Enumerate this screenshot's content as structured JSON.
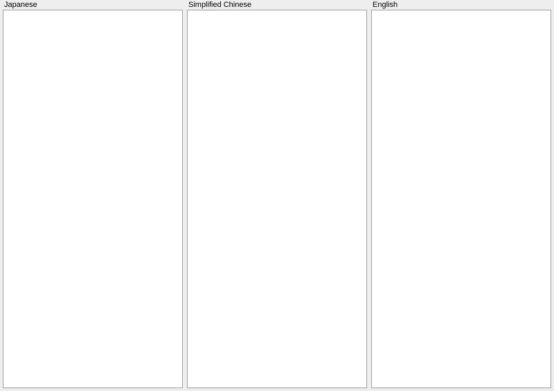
{
  "panels": [
    {
      "label": "Japanese",
      "value": ""
    },
    {
      "label": "Simplified Chinese",
      "value": ""
    },
    {
      "label": "English",
      "value": ""
    }
  ]
}
